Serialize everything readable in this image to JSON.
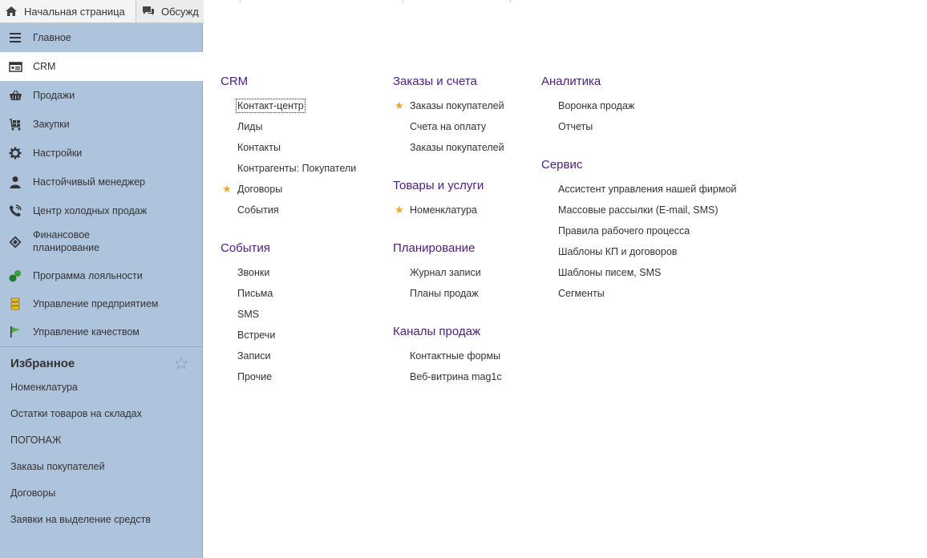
{
  "tabs": {
    "home": "Начальная страница",
    "discuss": "Обсужд"
  },
  "sidebar": {
    "items": [
      {
        "label": "Главное",
        "icon": "menu-lines-icon"
      },
      {
        "label": "CRM",
        "icon": "crm-card-icon",
        "active": true
      },
      {
        "label": "Продажи",
        "icon": "basket-icon"
      },
      {
        "label": "Закупки",
        "icon": "cart-icon"
      },
      {
        "label": "Настройки",
        "icon": "gear-icon"
      },
      {
        "label": "Настойчивый менеджер",
        "icon": "person-icon"
      },
      {
        "label": "Центр холодных продаж",
        "icon": "phone-icon"
      },
      {
        "label": "Финансовое",
        "label2": "планирование",
        "icon": "diamond-icon"
      },
      {
        "label": "Программа лояльности",
        "icon": "loyalty-icon"
      },
      {
        "label": "Управление предприятием",
        "icon": "stack-icon"
      },
      {
        "label": "Управление качеством",
        "icon": "flag-icon"
      }
    ],
    "favorites_title": "Избранное",
    "favorites": [
      "Номенклатура",
      "Остатки товаров на складах",
      "ПОГОНАЖ",
      "Заказы покупателей",
      "Договоры",
      "Заявки на выделение средств"
    ]
  },
  "sections": {
    "crm": {
      "title": "CRM",
      "links": [
        "Контакт-центр",
        "Лиды",
        "Контакты",
        "Контрагенты: Покупатели",
        "Договоры",
        "События"
      ]
    },
    "events": {
      "title": "События",
      "links": [
        "Звонки",
        "Письма",
        "SMS",
        "Встречи",
        "Записи",
        "Прочие"
      ]
    },
    "orders": {
      "title": "Заказы и счета",
      "links": [
        "Заказы покупателей",
        "Счета на оплату",
        "Заказы покупателей"
      ]
    },
    "goods": {
      "title": "Товары и услуги",
      "links": [
        "Номенклатура"
      ]
    },
    "planning": {
      "title": "Планирование",
      "links": [
        "Журнал записи",
        "Планы продаж"
      ]
    },
    "channels": {
      "title": "Каналы продаж",
      "links": [
        "Контактные формы",
        "Веб-витрина mag1c"
      ]
    },
    "analytics": {
      "title": "Аналитика",
      "links": [
        "Воронка продаж",
        "Отчеты"
      ]
    },
    "service": {
      "title": "Сервис",
      "links": [
        "Ассистент управления нашей фирмой",
        "Массовые рассылки (E-mail, SMS)",
        "Правила рабочего процесса",
        "Шаблоны КП и договоров",
        "Шаблоны писем, SMS",
        "Сегменты"
      ]
    }
  },
  "colors": {
    "sidebar_bg": "#aec3dc",
    "section_title": "#4b1c8c",
    "star": "#f5a623"
  }
}
